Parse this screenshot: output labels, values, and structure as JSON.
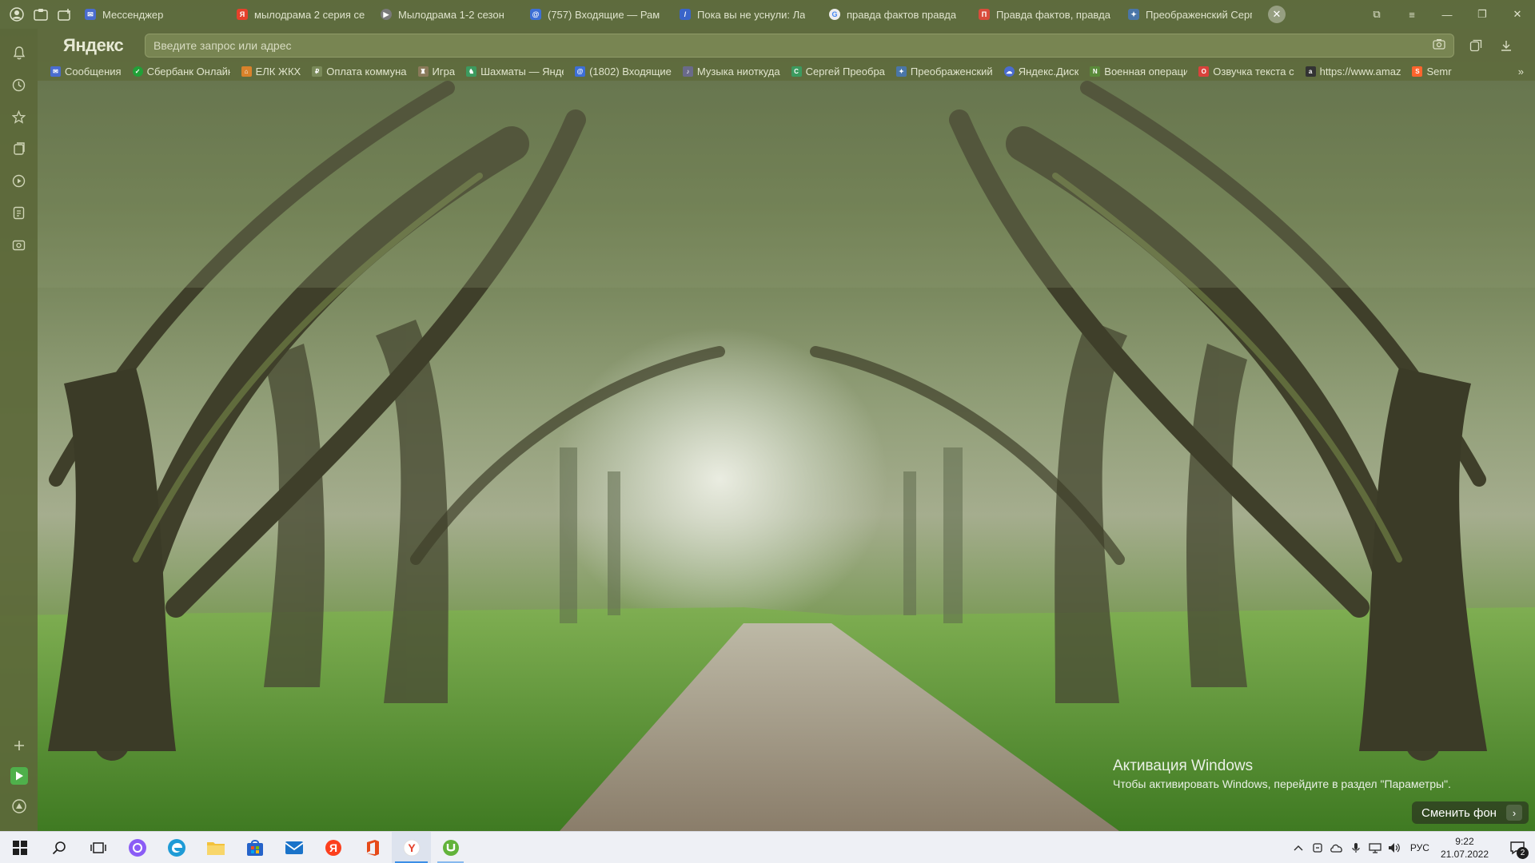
{
  "browser": {
    "tabs": [
      {
        "label": "Мессенджер",
        "icon": "messenger-icon",
        "color": "#4a6ccf"
      },
      {
        "label": "мылодрама 2 серия се",
        "icon": "yandex-icon",
        "color": "#e5412b"
      },
      {
        "label": "Мылодрама 1-2 сезон",
        "icon": "video-icon",
        "color": "#7a7a7a"
      },
      {
        "label": "(757) Входящие — Рам",
        "icon": "mail-icon",
        "color": "#3d6fd6"
      },
      {
        "label": "Пока вы не уснули: Ла",
        "icon": "zen-icon",
        "color": "#3964c9"
      },
      {
        "label": "правда фактов правда",
        "icon": "google-icon",
        "color": "#eeeeee"
      },
      {
        "label": "Правда фактов, правда",
        "icon": "page-icon",
        "color": "#d94c3b"
      },
      {
        "label": "Преображенский Серг",
        "icon": "vk-icon",
        "color": "#4a76a8"
      }
    ],
    "window_controls": {
      "minimize": "—",
      "maximize": "❐",
      "close": "✕"
    }
  },
  "omnibox": {
    "logo": "Яндекс",
    "placeholder": "Введите запрос или адрес"
  },
  "bookmarks": [
    {
      "label": "Сообщения",
      "icon": "messages-icon",
      "color": "#4a6ccf"
    },
    {
      "label": "Сбербанк Онлайн",
      "icon": "sberbank-icon",
      "color": "#21a038"
    },
    {
      "label": "ЕЛК ЖКХ",
      "icon": "housing-icon",
      "color": "#d9822b"
    },
    {
      "label": "Оплата коммуна",
      "icon": "payment-icon",
      "color": "#7a8a5a"
    },
    {
      "label": "Игра",
      "icon": "game-icon",
      "color": "#8a7a5a"
    },
    {
      "label": "Шахматы — Янде",
      "icon": "chess-icon",
      "color": "#3c9a5f"
    },
    {
      "label": "(1802) Входящие",
      "icon": "mail-icon",
      "color": "#3d6fd6"
    },
    {
      "label": "Музыка ниоткуда",
      "icon": "music-icon",
      "color": "#6a6a8a"
    },
    {
      "label": "Сергей Преобра",
      "icon": "page-icon",
      "color": "#3c9a5f"
    },
    {
      "label": "Преображенский",
      "icon": "vk-icon",
      "color": "#4a76a8"
    },
    {
      "label": "Яндекс.Диск",
      "icon": "disk-icon",
      "color": "#4a6ccf"
    },
    {
      "label": "Военная операци",
      "icon": "news-icon",
      "color": "#5a8a3a"
    },
    {
      "label": "Озвучка текста с",
      "icon": "speech-icon",
      "color": "#d9423b"
    },
    {
      "label": "https://www.amaz",
      "icon": "amazon-icon",
      "color": "#333333"
    },
    {
      "label": "Semr",
      "icon": "semrush-icon",
      "color": "#ff642d"
    }
  ],
  "activation": {
    "title": "Активация Windows",
    "subtitle": "Чтобы активировать Windows, перейдите в раздел \"Параметры\"."
  },
  "change_background": {
    "label": "Сменить фон"
  },
  "taskbar": {
    "language": "РУС",
    "time": "9:22",
    "date": "21.07.2022",
    "notifications": "2"
  }
}
